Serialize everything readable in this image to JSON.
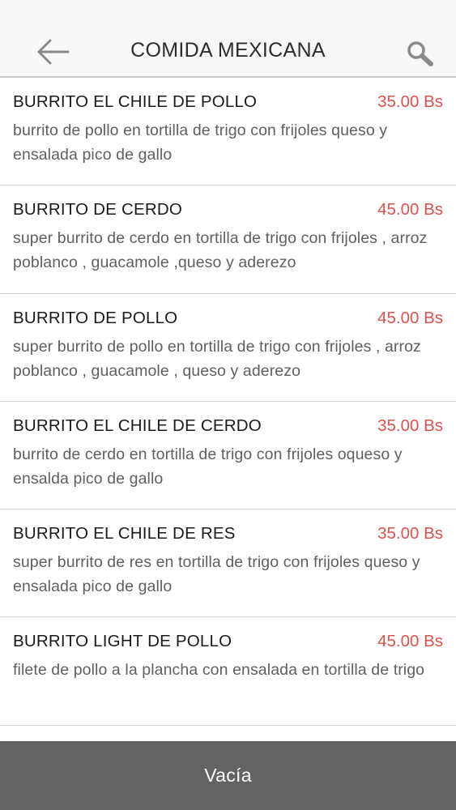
{
  "header": {
    "title": "COMIDA MEXICANA",
    "back_icon": "arrow-left-icon",
    "search_icon": "search-icon"
  },
  "colors": {
    "price": "#d9534f",
    "footer_bg": "#636363",
    "header_bg": "#f7f7f7"
  },
  "items": [
    {
      "name": "BURRITO EL CHILE DE POLLO",
      "price": "35.00 Bs",
      "description": "burrito de pollo en tortilla de trigo con frijoles queso y ensalada pico de gallo"
    },
    {
      "name": "BURRITO DE CERDO",
      "price": "45.00 Bs",
      "description": "super burrito de cerdo en tortilla de trigo con frijoles , arroz poblanco , guacamole ,queso y aderezo"
    },
    {
      "name": "BURRITO DE POLLO",
      "price": "45.00 Bs",
      "description": "super burrito de pollo en tortilla de trigo con frijoles , arroz poblanco , guacamole , queso y aderezo"
    },
    {
      "name": "BURRITO EL CHILE DE CERDO",
      "price": "35.00 Bs",
      "description": "burrito de cerdo en tortilla de trigo con frijoles oqueso y ensalda pico de gallo"
    },
    {
      "name": "BURRITO EL CHILE DE RES",
      "price": "35.00 Bs",
      "description": "super burrito de res en tortilla de trigo con frijoles queso y ensalada pico de gallo"
    },
    {
      "name": "BURRITO LIGHT DE POLLO",
      "price": "45.00 Bs",
      "description": "filete de pollo a la plancha con ensalada en tortilla de trigo"
    }
  ],
  "footer": {
    "label": "Vacía"
  }
}
